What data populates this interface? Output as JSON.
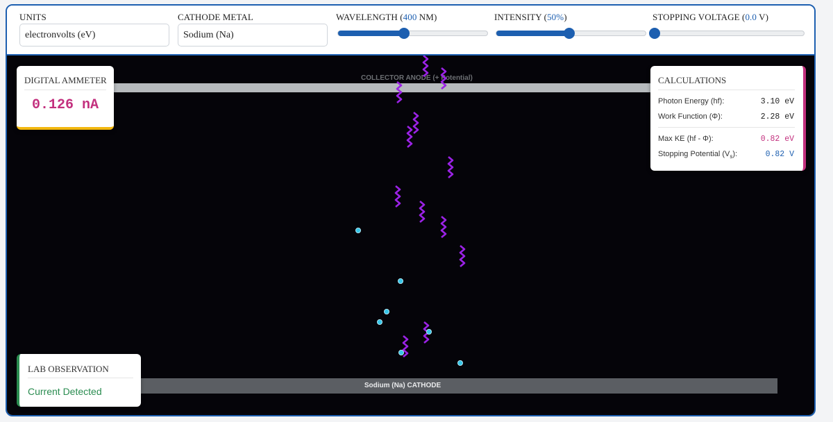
{
  "controls": {
    "units": {
      "label": "UNITS",
      "value": "electronvolts (eV)"
    },
    "cathode": {
      "label": "CATHODE METAL",
      "value": "Sodium (Na)"
    },
    "wavelength": {
      "label_prefix": "WAVELENGTH (",
      "value_text": "400",
      "label_suffix": " NM)",
      "fraction": 0.44
    },
    "intensity": {
      "label_prefix": "INTENSITY (",
      "value_text": "50%",
      "label_suffix": ")",
      "fraction": 0.49
    },
    "stopping_voltage": {
      "label_prefix": "STOPPING VOLTAGE (",
      "value_text": "0.0",
      "label_suffix": " V)",
      "fraction": 0.0
    }
  },
  "stage": {
    "anode_label": "COLLECTOR ANODE (+ Potential)",
    "cathode_label": "Sodium (Na) CATHODE",
    "colors": {
      "photon": "#9b22e6",
      "electron": "#38c6e8",
      "background": "#050409"
    }
  },
  "ammeter": {
    "title": "DIGITAL AMMETER",
    "reading": "0.126 nA",
    "accent": "#f2b70f"
  },
  "calculations": {
    "title": "CALCULATIONS",
    "accent": "#c3307e",
    "photon_energy": {
      "label": "Photon Energy (hf):",
      "value": "3.10 eV"
    },
    "work_function": {
      "label": "Work Function (Φ):",
      "value": "2.28 eV"
    },
    "max_ke": {
      "label": "Max KE (hf - Φ):",
      "value": "0.82 eV"
    },
    "stopping_potential": {
      "label_main": "Stopping Potential (V",
      "label_sub": "s",
      "label_end": "):",
      "value": "0.82 V"
    }
  },
  "observation": {
    "title": "LAB OBSERVATION",
    "status": "Current Detected",
    "accent": "#2a8c50"
  }
}
